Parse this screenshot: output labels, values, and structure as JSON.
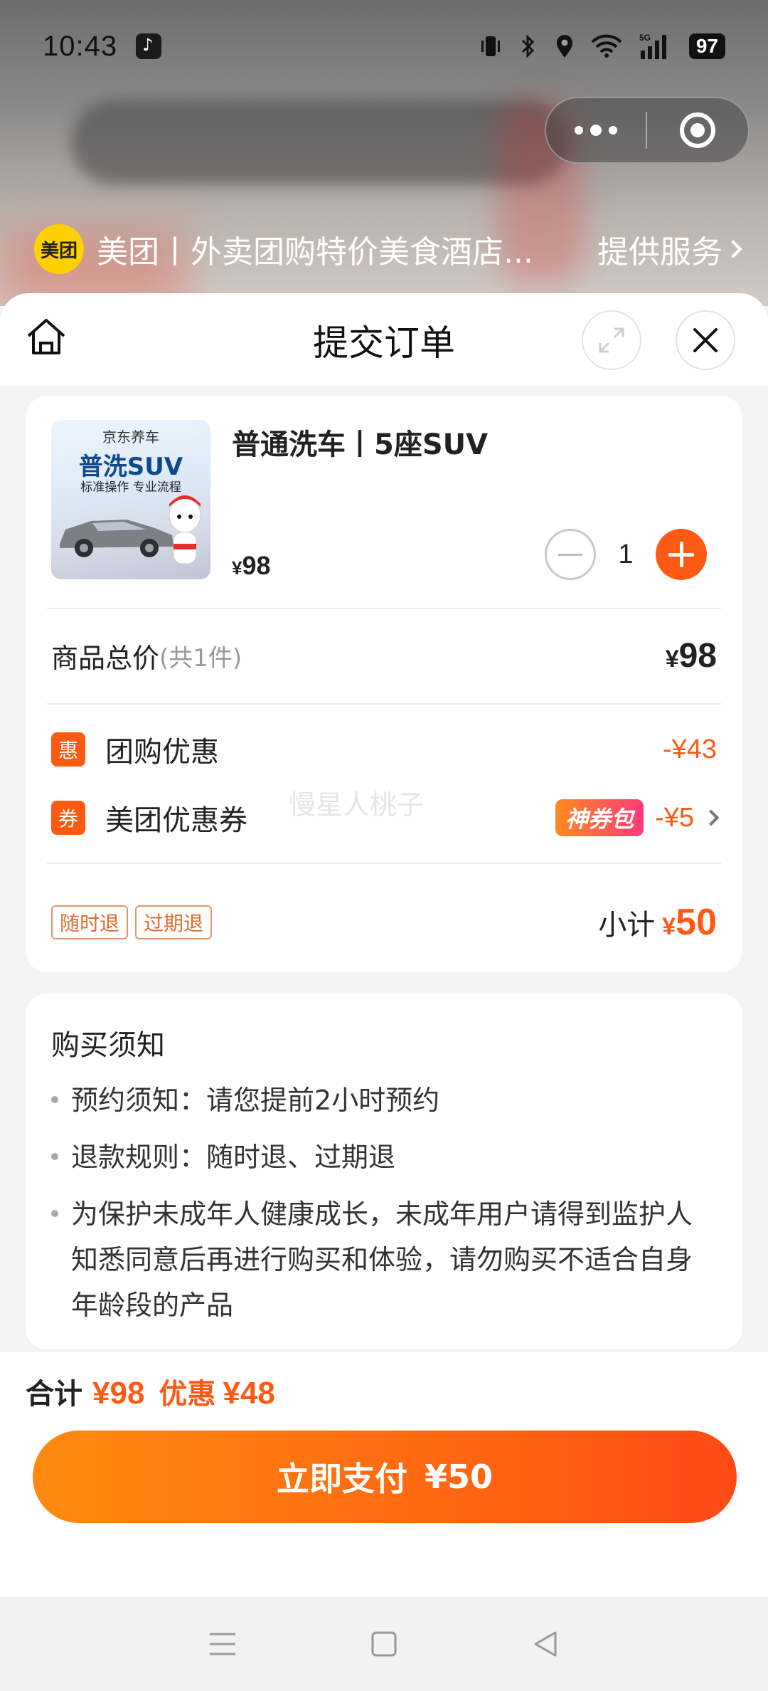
{
  "status_bar": {
    "time": "10:43",
    "battery": "97",
    "network": "5G"
  },
  "service": {
    "logo_text": "美团",
    "name": "美团丨外卖团购特价美食酒店...",
    "link_label": "提供服务"
  },
  "header": {
    "title": "提交订单"
  },
  "product": {
    "image": {
      "brand": "京东养车",
      "title": "普洗SUV",
      "subtitle": "标准操作 专业流程"
    },
    "name": "普通洗车丨5座SUV",
    "price_symbol": "¥",
    "price": "98",
    "quantity": "1"
  },
  "totals": {
    "label": "商品总价",
    "count": "(共1件)",
    "symbol": "¥",
    "value": "98"
  },
  "discounts": [
    {
      "tag": "惠",
      "label": "团购优惠",
      "amount": "-¥43"
    },
    {
      "tag": "券",
      "label": "美团优惠券",
      "badge": "神券包",
      "amount": "-¥5"
    }
  ],
  "watermark": "慢星人桃子",
  "policy_tags": [
    "随时退",
    "过期退"
  ],
  "subtotal": {
    "label": "小计",
    "symbol": "¥",
    "value": "50"
  },
  "notice": {
    "title": "购买须知",
    "items": [
      "预约须知：请您提前2小时预约",
      "退款规则：随时退、过期退",
      "为保护未成年人健康成长，未成年用户请得到监护人知悉同意后再进行购买和体验，请勿购买不适合自身年龄段的产品"
    ]
  },
  "pay_bar": {
    "total_label": "合计",
    "total_value": "¥98",
    "discount_label": "优惠",
    "discount_value": "¥48",
    "button_label": "立即支付",
    "button_amount": "¥50"
  },
  "colors": {
    "accent": "#ff5a14",
    "meituan_yellow": "#ffd100"
  }
}
